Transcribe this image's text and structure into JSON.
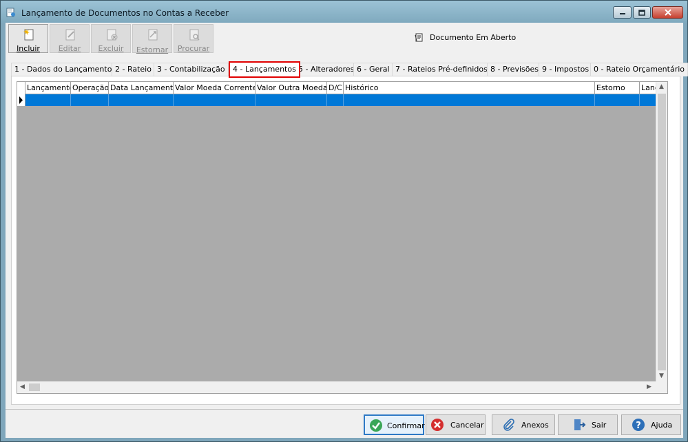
{
  "window": {
    "title": "Lançamento de Documentos no Contas a Receber"
  },
  "toolbar": {
    "buttons": [
      {
        "label": "Incluir",
        "enabled": true
      },
      {
        "label": "Editar",
        "enabled": false
      },
      {
        "label": "Excluir",
        "enabled": false
      },
      {
        "label": "Estornar",
        "enabled": false
      },
      {
        "label": "Procurar",
        "enabled": false
      }
    ],
    "status": "Documento Em Aberto"
  },
  "tabs": [
    {
      "label": "1 - Dados do Lançamento"
    },
    {
      "label": "2 - Rateio"
    },
    {
      "label": "3 - Contabilização"
    },
    {
      "label": "4 - Lançamentos",
      "active": true
    },
    {
      "label": "5 - Alteradores"
    },
    {
      "label": "6 - Geral"
    },
    {
      "label": "7 - Rateios Pré-definidos"
    },
    {
      "label": "8 - Previsões"
    },
    {
      "label": "9 - Impostos"
    },
    {
      "label": "0 - Rateio Orçamentário"
    }
  ],
  "grid": {
    "columns": [
      "Lançamento",
      "Operação",
      "Data Lançamento",
      "Valor Moeda Corrente",
      "Valor Outra Moeda",
      "D/C",
      "Histórico",
      "Estorno",
      "Lança"
    ],
    "selection_color": "#0078d7"
  },
  "footer": {
    "confirm": "Confirmar",
    "cancel": "Cancelar",
    "attachments": "Anexos",
    "exit": "Sair",
    "help": "Ajuda"
  }
}
